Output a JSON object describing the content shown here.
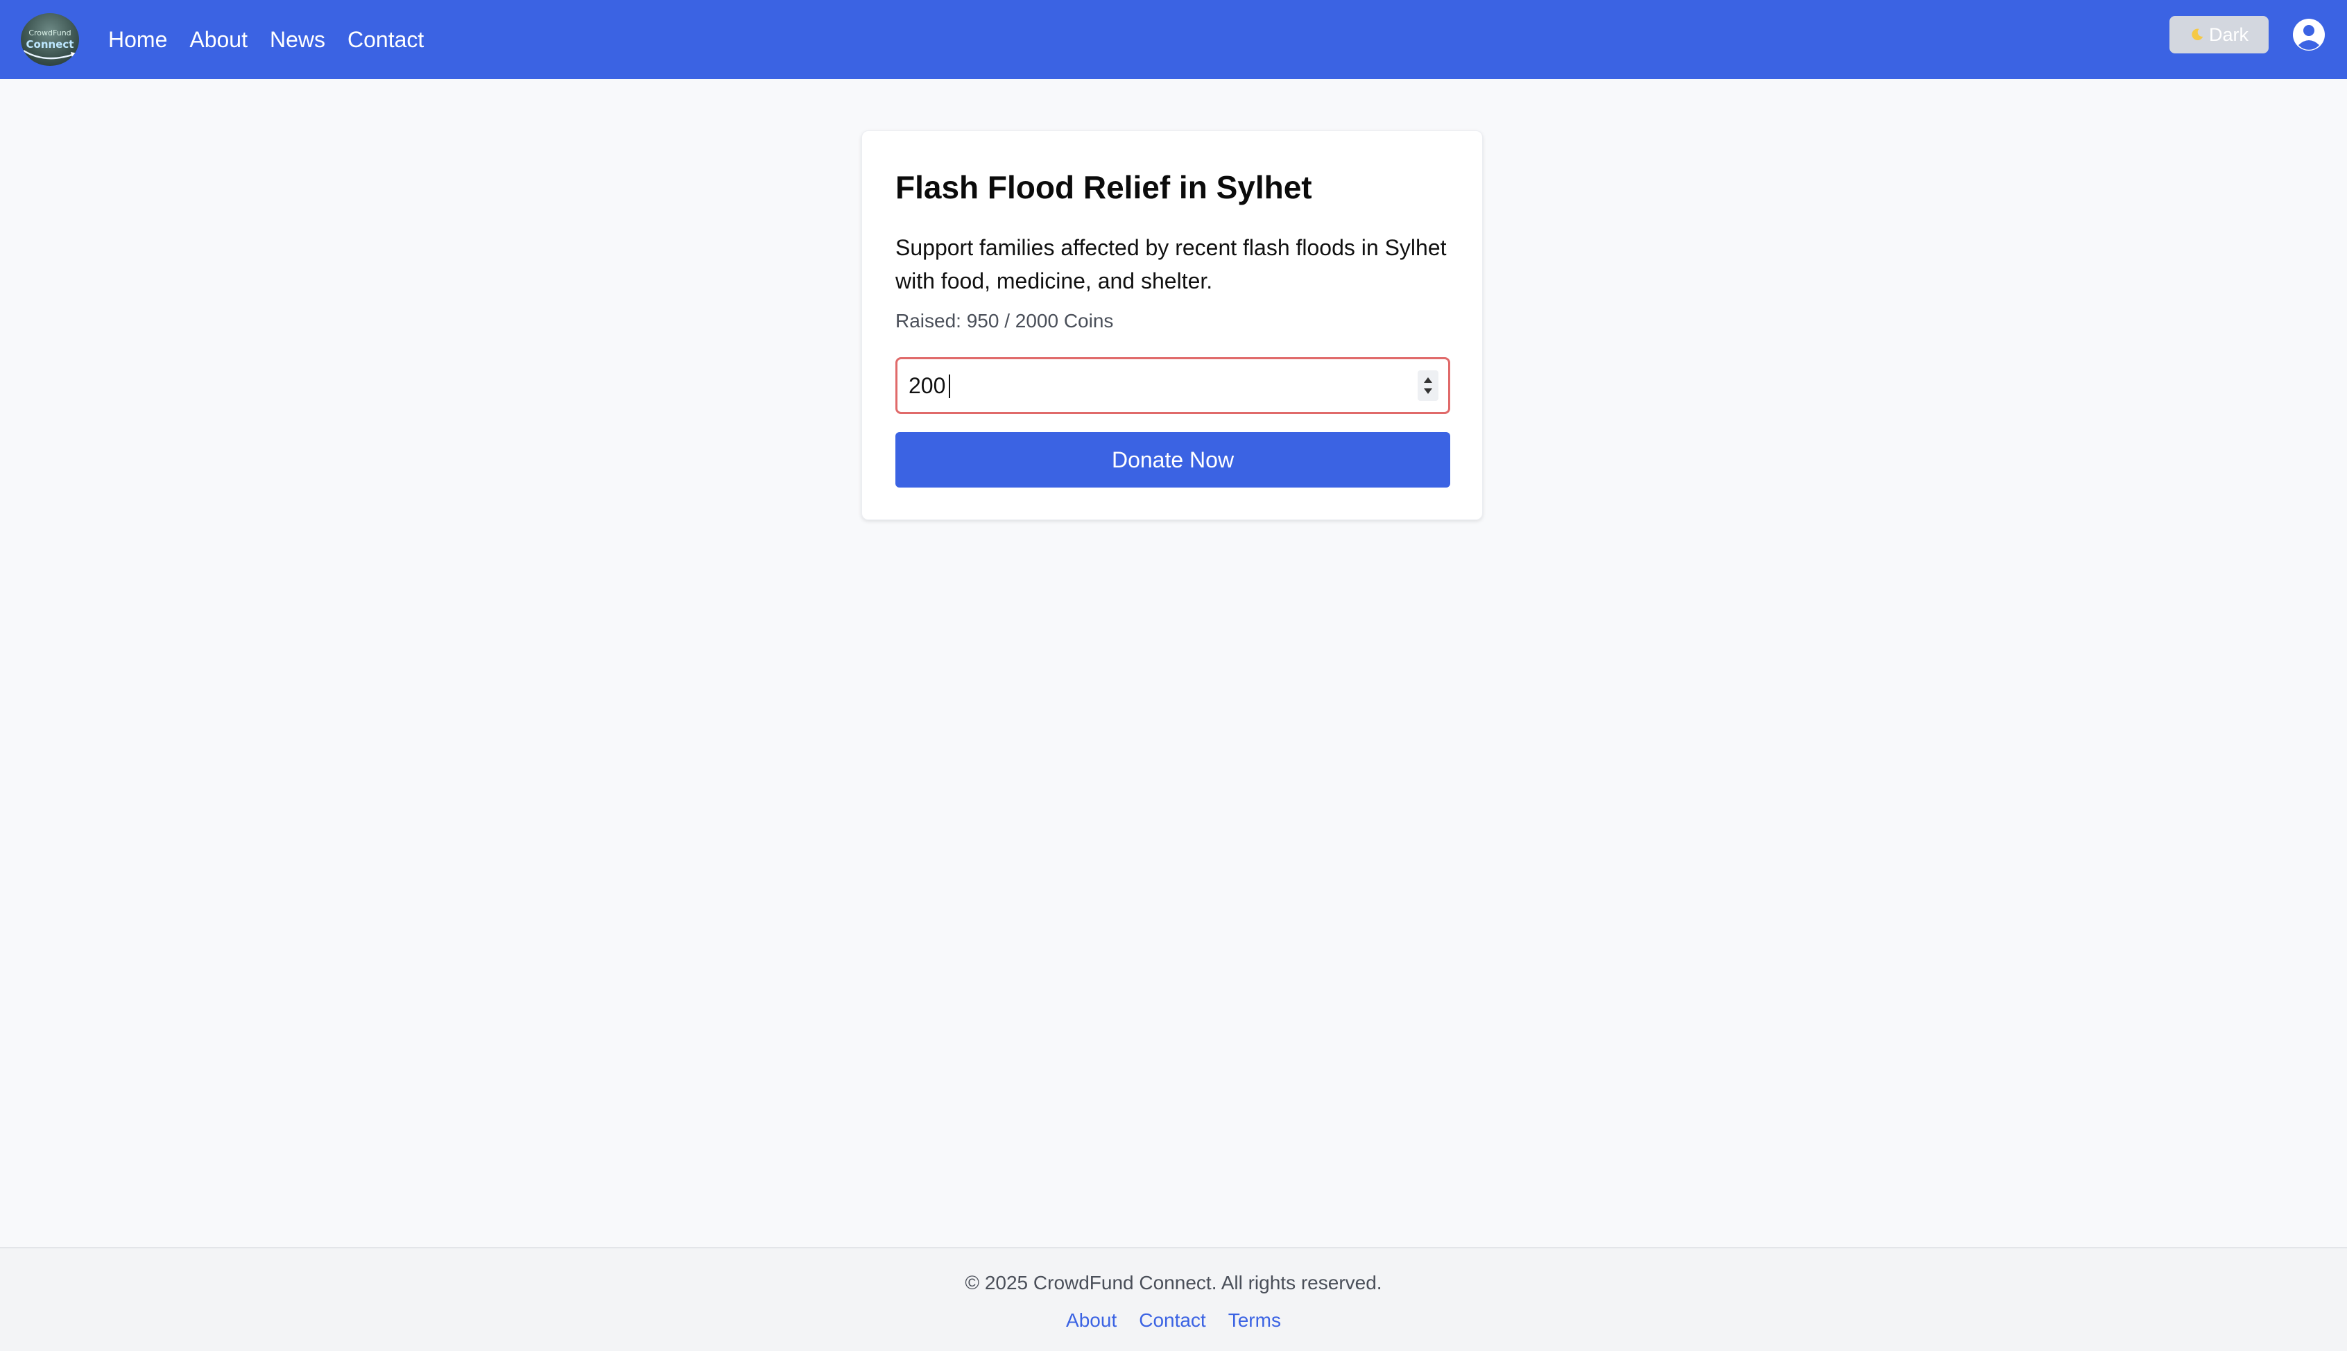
{
  "navbar": {
    "logo_text_line1": "CrowdFund",
    "logo_text_line2": "Connect",
    "links": [
      "Home",
      "About",
      "News",
      "Contact"
    ],
    "theme_toggle_icon": "moon-icon",
    "theme_toggle_label": "Dark",
    "user_icon": "user-circle-icon",
    "background_color": "#3b63e3"
  },
  "campaign": {
    "title": "Flash Flood Relief in Sylhet",
    "description": "Support families affected by recent flash floods in Sylhet with food, medicine, and shelter.",
    "raised_text": "Raised: 950 / 2000 Coins",
    "amount_value": "200",
    "donate_label": "Donate Now"
  },
  "footer": {
    "copyright": "© 2025 CrowdFund Connect. All rights reserved.",
    "links": [
      "About",
      "Contact",
      "Terms"
    ]
  },
  "colors": {
    "primary": "#3b63e3",
    "input_error_border": "#e06a6a",
    "page_background": "#f8f9fb"
  }
}
